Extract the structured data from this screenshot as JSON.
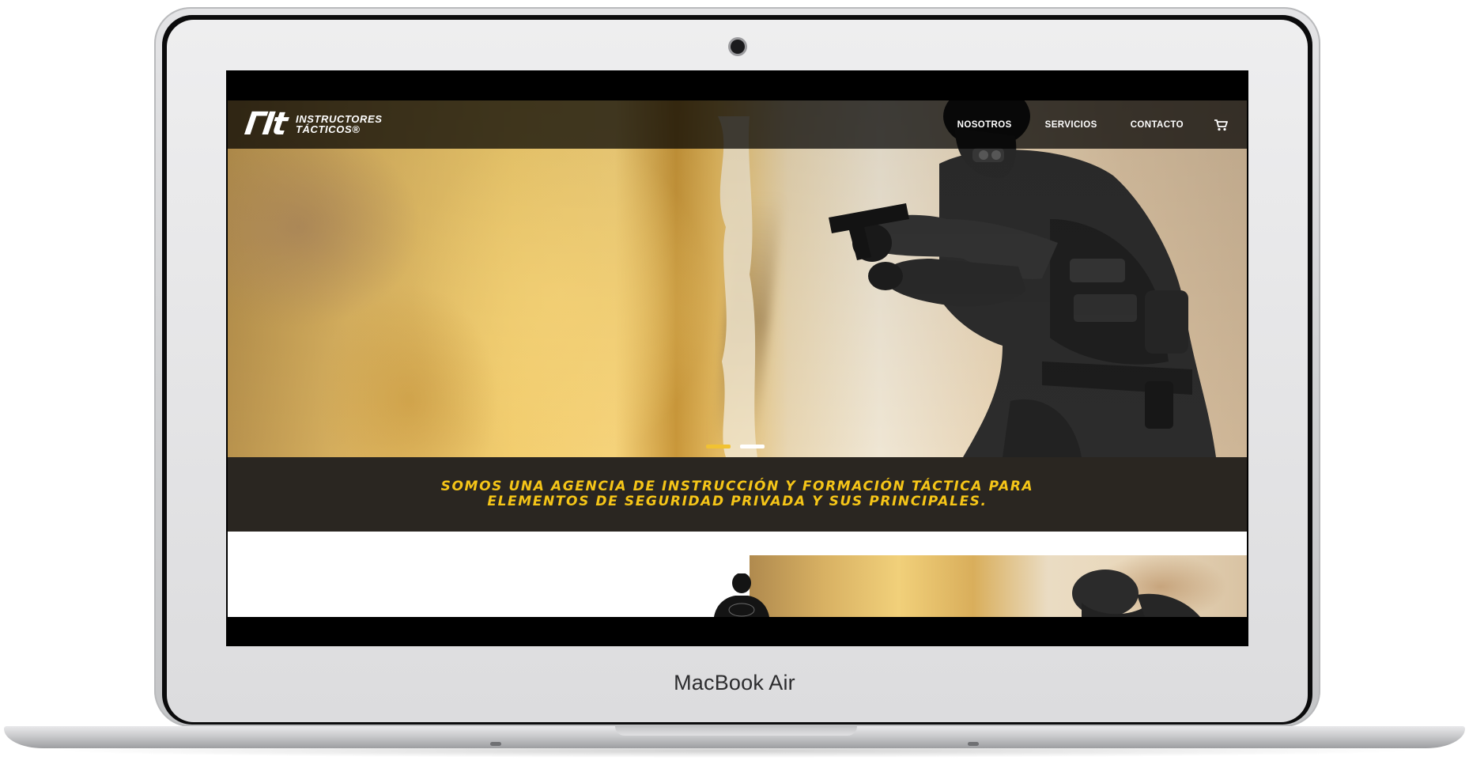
{
  "device": {
    "brand_label": "MacBook Air"
  },
  "site": {
    "logo": {
      "mark": "ΓIt",
      "line1": "INSTRUCTORES",
      "line2": "TÁCTICOS®"
    },
    "nav": {
      "items": [
        {
          "label": "NOSOTROS"
        },
        {
          "label": "SERVICIOS"
        },
        {
          "label": "CONTACTO"
        }
      ],
      "cart_icon": "shopping-cart-icon"
    },
    "slider": {
      "slides": 2,
      "active_index": 0
    },
    "tagline": {
      "line1": "SOMOS UNA AGENCIA DE INSTRUCCIÓN Y FORMACIÓN TÁCTICA PARA",
      "line2": "ELEMENTOS DE SEGURIDAD PRIVADA Y SUS PRINCIPALES."
    }
  },
  "colors": {
    "accent_yellow": "#f5c518",
    "band_background": "#2a2621",
    "nav_background": "#000000"
  }
}
